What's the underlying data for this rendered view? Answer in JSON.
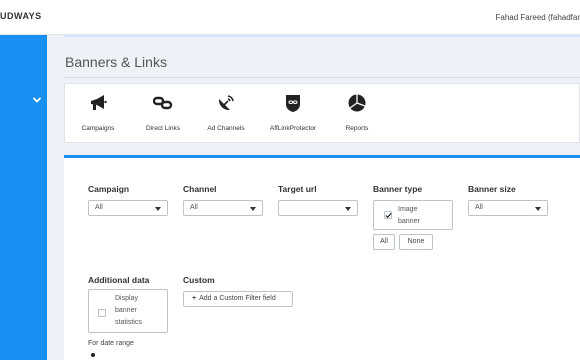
{
  "topbar": {
    "brand": "UDWAYS",
    "user": "Fahad Fareed (fahadfar"
  },
  "page": {
    "title": "Banners & Links"
  },
  "nav": [
    {
      "label": "Campaigns",
      "icon": "megaphone-icon"
    },
    {
      "label": "Direct Links",
      "icon": "link-icon"
    },
    {
      "label": "Ad Channels",
      "icon": "satellite-dish-icon"
    },
    {
      "label": "AffLinkProtector",
      "icon": "shield-icon"
    },
    {
      "label": "Reports",
      "icon": "pie-chart-icon"
    }
  ],
  "filters": {
    "campaign": {
      "label": "Campaign",
      "value": "All"
    },
    "channel": {
      "label": "Channel",
      "value": "All"
    },
    "target_url": {
      "label": "Target url",
      "value": ""
    },
    "banner_type": {
      "label": "Banner type",
      "option_line1": "Image",
      "option_line2": "banner",
      "checked": true,
      "all_label": "All",
      "none_label": "None"
    },
    "banner_size": {
      "label": "Banner size",
      "value": "All"
    },
    "additional_data": {
      "label": "Additional data",
      "line1": "Display",
      "line2": "banner",
      "line3": "statistics",
      "checked": false
    },
    "custom": {
      "label": "Custom",
      "button_label": "Add a Custom Filter field"
    },
    "date_range_label": "For date range"
  },
  "colors": {
    "sidebar": "#1890f1",
    "accent": "#1890f1",
    "background": "#eef1f5"
  }
}
